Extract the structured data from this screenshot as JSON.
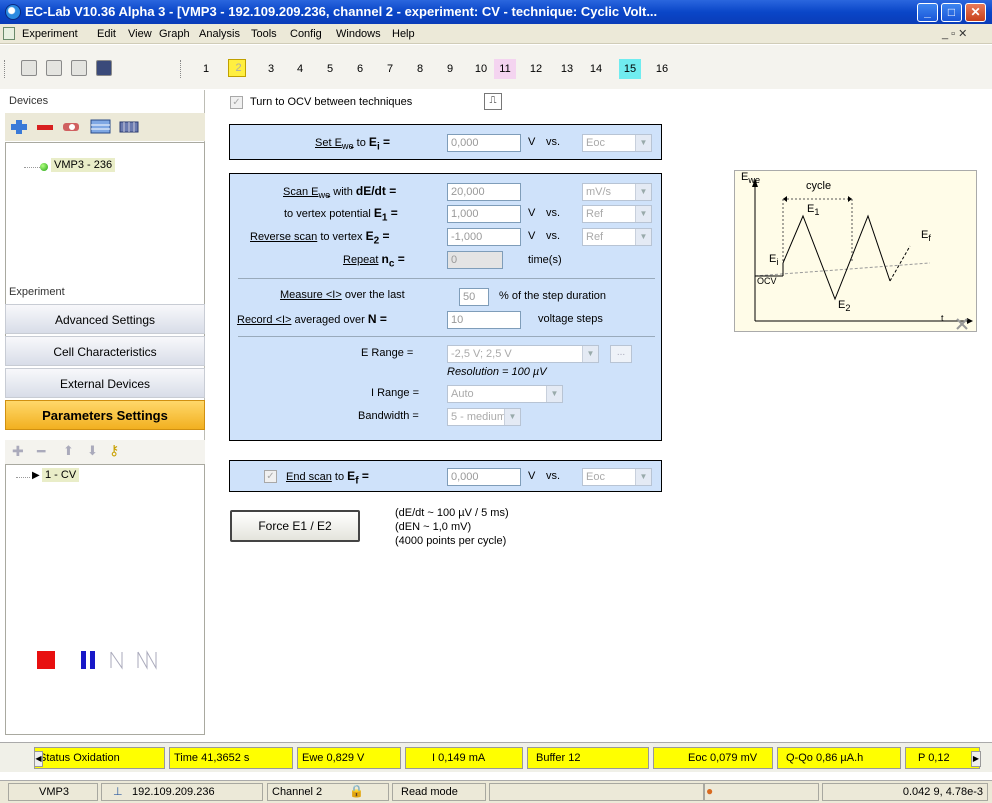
{
  "window": {
    "title": "EC-Lab V10.36 Alpha 3 - [VMP3 - 192.109.209.236, channel 2 - experiment: CV - technique: Cyclic Volt...",
    "min": "_",
    "max": "□",
    "close": "✕"
  },
  "menu": [
    "Experiment",
    "Edit",
    "View",
    "Graph",
    "Analysis",
    "Tools",
    "Config",
    "Windows",
    "Help"
  ],
  "menu_controls": "_ ▫ ✕",
  "channels": [
    "1",
    "2",
    "3",
    "4",
    "5",
    "6",
    "7",
    "8",
    "9",
    "10",
    "11",
    "12",
    "13",
    "14",
    "15",
    "16"
  ],
  "selected_channel": "2",
  "left": {
    "devices_title": "Devices",
    "device_name": "VMP3 - 236",
    "experiment_title": "Experiment",
    "buttons": [
      "Advanced Settings",
      "Cell Characteristics",
      "External Devices",
      "Parameters Settings"
    ],
    "technique": "1 - CV"
  },
  "params": {
    "turn_ocv": "Turn to OCV between techniques",
    "set_ewe": "Set E",
    "set_ewe_sub": "we",
    "set_to": " to ",
    "ei_label": "E",
    "ei_sub": "i",
    "eq": " = ",
    "ei_value": "0,000",
    "v": "V",
    "vs": "vs.",
    "ei_ref": "Eoc",
    "scan_label": "Scan E",
    "scan_sub": "we",
    "scan_with": " with ",
    "dedt": "dE/dt",
    "scan_value": "20,000",
    "scan_unit": "mV/s",
    "vertex_label": "to vertex potential ",
    "e1": "E",
    "e1_sub": "1",
    "e1_value": "1,000",
    "e1_ref": "Ref",
    "reverse_label": "Reverse scan",
    "reverse_rest": " to vertex ",
    "e2": "E",
    "e2_sub": "2",
    "e2_value": "-1,000",
    "e2_ref": "Ref",
    "repeat_label": "Repeat",
    "nc": "n",
    "nc_sub": "c",
    "nc_value": "0",
    "times": "time(s)",
    "measure_label": "Measure <I>",
    "measure_rest": " over the last ",
    "measure_value": "50",
    "measure_unit": "% of the step duration",
    "record_label": "Record <I>",
    "record_rest": " averaged over ",
    "n_label": "N",
    "record_value": "10",
    "record_unit": "voltage steps",
    "erange_label": "E Range =",
    "erange_value": "-2,5 V; 2,5 V",
    "resolution": "Resolution = 100 µV",
    "irange_label": "I Range =",
    "irange_value": "Auto",
    "bandwidth_label": "Bandwidth =",
    "bandwidth_value": "5 - medium",
    "end_scan": "End scan",
    "end_to": " to ",
    "ef": "E",
    "ef_sub": "f",
    "ef_value": "0,000",
    "ef_ref": "Eoc",
    "ellipsis": "..."
  },
  "force_button": "Force E1 / E2",
  "notes": [
    "(dE/dt ~ 100 µV / 5 ms)",
    "(dEN ~ 1,0 mV)",
    "(4000 points per cycle)"
  ],
  "diagram": {
    "ewe": "E",
    "ewe_sub": "we",
    "cycle": "cycle",
    "e1": "E",
    "e1_sub": "1",
    "e2": "E",
    "e2_sub": "2",
    "ei": "E",
    "ei_sub": "i",
    "ef": "E",
    "ef_sub": "f",
    "ocv": "OCV",
    "t": "t"
  },
  "status": [
    "Status  Oxidation",
    "Time  41,3652 s",
    "Ewe  0,829 V",
    "I  0,149 mA",
    "Buffer  12",
    "Eoc  0,079 mV",
    "Q-Qo  0,86 µA.h",
    "P  0,12"
  ],
  "bottom": {
    "device": "VMP3",
    "ip": "192.109.209.236",
    "channel": "Channel 2",
    "mode": "Read mode",
    "coords": "0.042 9, 4.78e-3"
  },
  "colors": {
    "title_bar": "#0a46c8",
    "active_button": "#f2b020",
    "param_box": "#cfe2fa",
    "status_yellow": "#ffff00",
    "channel_selected": "#ffef40"
  }
}
